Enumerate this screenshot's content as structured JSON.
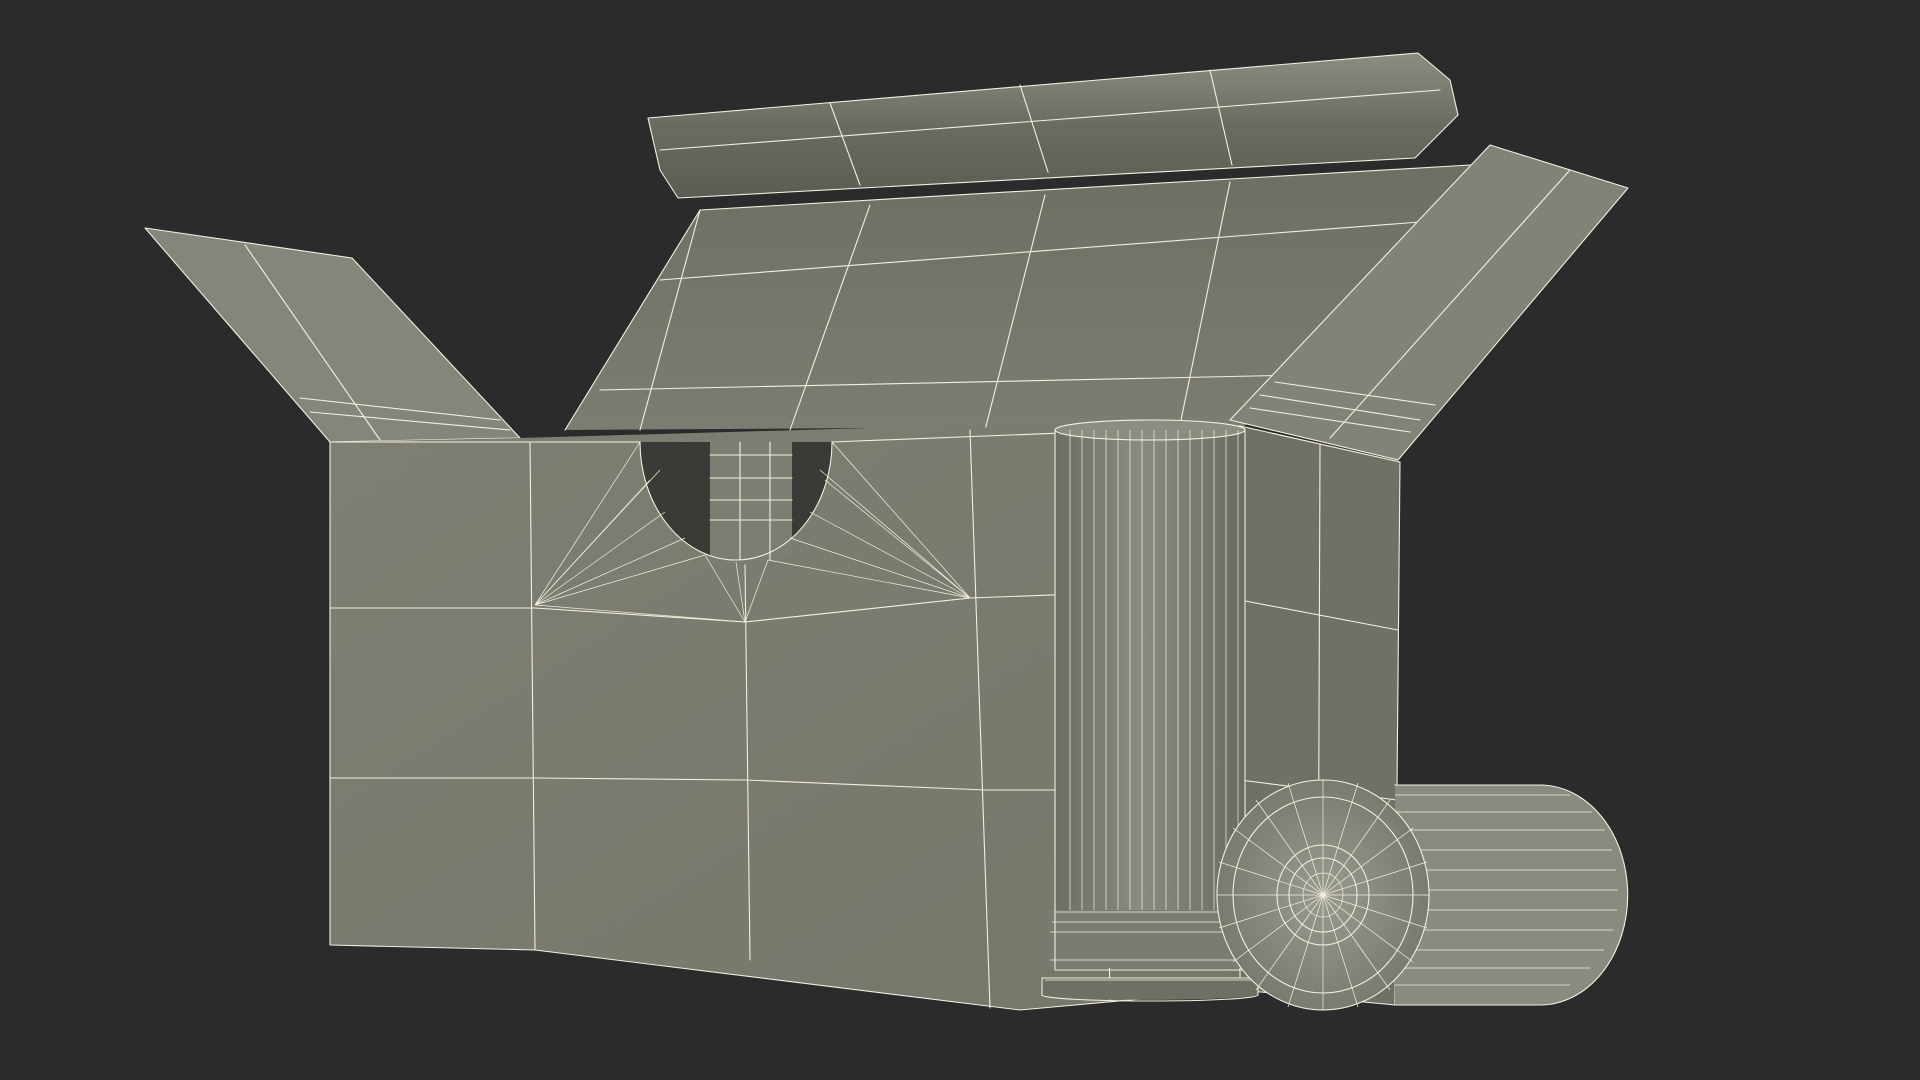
{
  "scene": {
    "colors": {
      "background": "#2b2b2b",
      "surface": "#7b7c70",
      "surface_light": "#8a8b80",
      "surface_dark": "#5c5d54",
      "cavity": "#3a3b36",
      "wire": "#f3efdc"
    }
  }
}
